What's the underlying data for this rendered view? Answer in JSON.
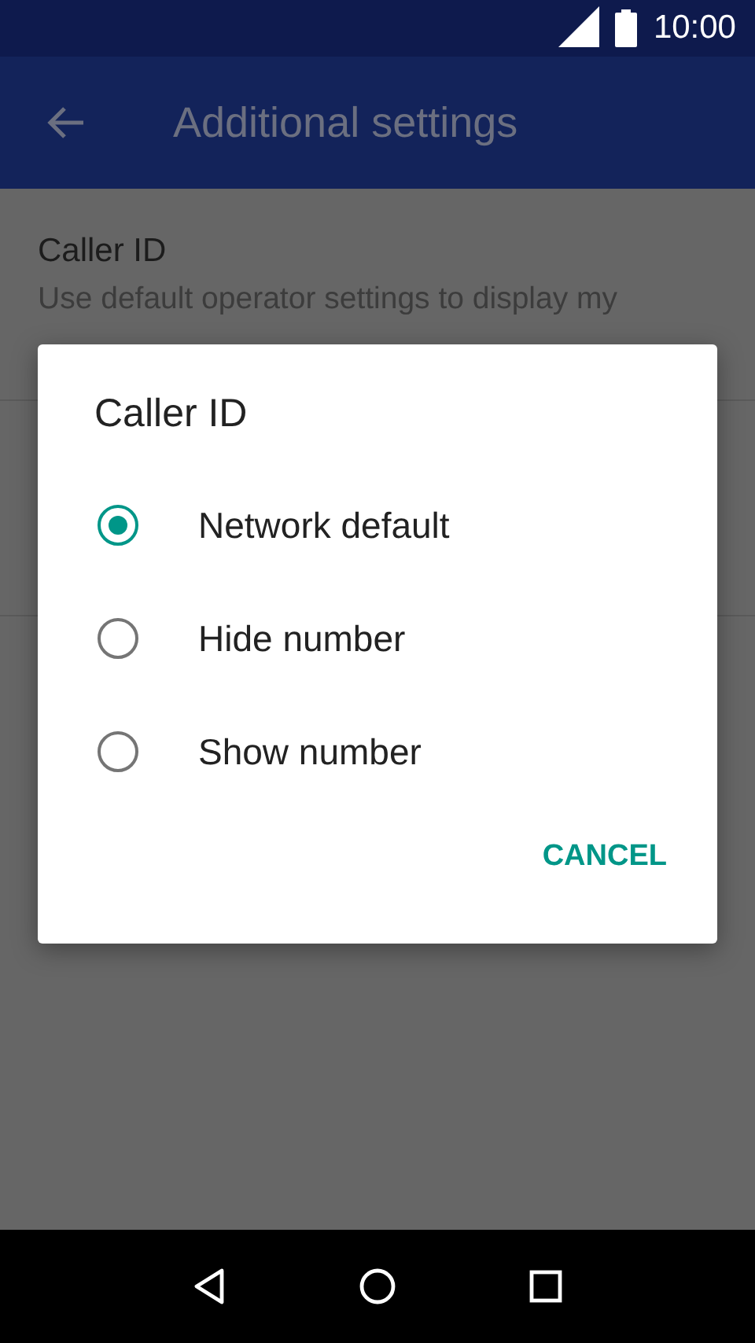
{
  "status_bar": {
    "time": "10:00"
  },
  "app_bar": {
    "title": "Additional settings"
  },
  "settings": [
    {
      "title": "Caller ID",
      "summary": "Use default operator settings to display my"
    }
  ],
  "dialog": {
    "title": "Caller ID",
    "options": [
      {
        "label": "Network default",
        "selected": true
      },
      {
        "label": "Hide number",
        "selected": false
      },
      {
        "label": "Show number",
        "selected": false
      }
    ],
    "buttons": [
      "CANCEL"
    ]
  }
}
